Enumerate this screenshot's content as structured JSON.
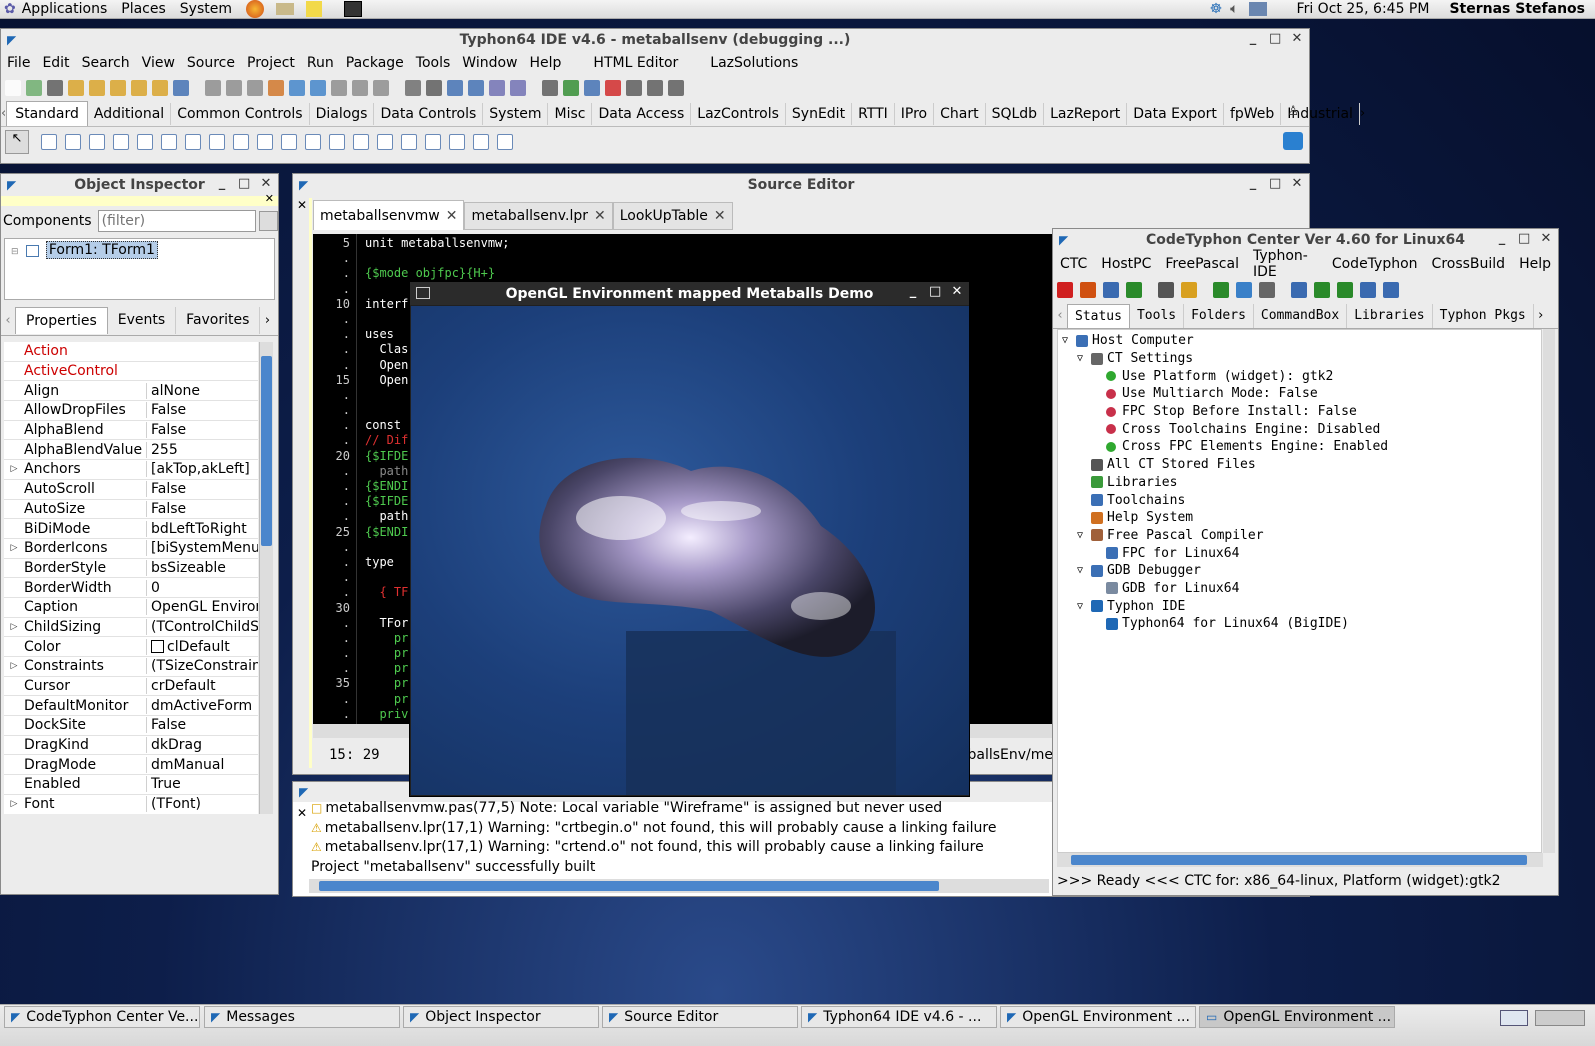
{
  "topbar": {
    "applications": "Applications",
    "places": "Places",
    "system": "System",
    "clock": "Fri Oct 25,  6:45 PM",
    "user": "Sternas Stefanos"
  },
  "ide": {
    "title": "Typhon64 IDE v4.6 - metaballsenv (debugging ...)",
    "menu": [
      "File",
      "Edit",
      "Search",
      "View",
      "Source",
      "Project",
      "Run",
      "Package",
      "Tools",
      "Window",
      "Help",
      "HTML Editor",
      "LazSolutions"
    ],
    "palette_tabs": [
      "Standard",
      "Additional",
      "Common Controls",
      "Dialogs",
      "Data Controls",
      "System",
      "Misc",
      "Data Access",
      "LazControls",
      "SynEdit",
      "RTTI",
      "IPro",
      "Chart",
      "SQLdb",
      "LazReport",
      "Data Export",
      "fpWeb",
      "Industrial"
    ]
  },
  "inspector": {
    "title": "Object Inspector",
    "components_label": "Components",
    "filter_placeholder": "(filter)",
    "tree_item": "Form1: TForm1",
    "tabs": [
      "Properties",
      "Events",
      "Favorites"
    ],
    "props": [
      {
        "n": "Action",
        "v": "",
        "red": true,
        "e": ""
      },
      {
        "n": "ActiveControl",
        "v": "",
        "red": true,
        "e": ""
      },
      {
        "n": "Align",
        "v": "alNone",
        "e": ""
      },
      {
        "n": "AllowDropFiles",
        "v": "False",
        "e": ""
      },
      {
        "n": "AlphaBlend",
        "v": "False",
        "e": ""
      },
      {
        "n": "AlphaBlendValue",
        "v": "255",
        "e": ""
      },
      {
        "n": "Anchors",
        "v": "[akTop,akLeft]",
        "e": "▷"
      },
      {
        "n": "AutoScroll",
        "v": "False",
        "e": ""
      },
      {
        "n": "AutoSize",
        "v": "False",
        "e": ""
      },
      {
        "n": "BiDiMode",
        "v": "bdLeftToRight",
        "e": ""
      },
      {
        "n": "BorderIcons",
        "v": "[biSystemMenu,b",
        "e": "▷"
      },
      {
        "n": "BorderStyle",
        "v": "bsSizeable",
        "e": ""
      },
      {
        "n": "BorderWidth",
        "v": "0",
        "e": ""
      },
      {
        "n": "Caption",
        "v": "OpenGL Environn",
        "e": ""
      },
      {
        "n": "ChildSizing",
        "v": "(TControlChildSiz",
        "e": "▷"
      },
      {
        "n": "Color",
        "v": "clDefault",
        "e": "",
        "swatch": true
      },
      {
        "n": "Constraints",
        "v": "(TSizeConstraints",
        "e": "▷"
      },
      {
        "n": "Cursor",
        "v": "crDefault",
        "e": ""
      },
      {
        "n": "DefaultMonitor",
        "v": "dmActiveForm",
        "e": ""
      },
      {
        "n": "DockSite",
        "v": "False",
        "e": ""
      },
      {
        "n": "DragKind",
        "v": "dkDrag",
        "e": ""
      },
      {
        "n": "DragMode",
        "v": "dmManual",
        "e": ""
      },
      {
        "n": "Enabled",
        "v": "True",
        "e": ""
      },
      {
        "n": "Font",
        "v": "(TFont)",
        "e": "▷"
      }
    ]
  },
  "source": {
    "title": "Source Editor",
    "tabs": [
      "metaballsenvmw",
      "metaballsenv.lpr",
      "LookUpTable"
    ],
    "cursor_pos": "15: 29",
    "path_fragment": "aballsEnv/me",
    "gutter": [
      "5",
      ".",
      ".",
      ".",
      "10",
      ".",
      ".",
      ".",
      ".",
      "15",
      ".",
      ".",
      ".",
      ".",
      "20",
      ".",
      ".",
      ".",
      ".",
      "25",
      ".",
      ".",
      ".",
      ".",
      "30",
      ".",
      ".",
      ".",
      ".",
      "35",
      ".",
      "."
    ],
    "lines": [
      {
        "t": "unit metaballsenvmw;",
        "c": "#ffffff"
      },
      {
        "t": "",
        "c": "#fff"
      },
      {
        "t": "{$mode objfpc}{H+}",
        "c": "#4ec94e"
      },
      {
        "t": "",
        "c": "#fff"
      },
      {
        "t": "interface",
        "c": "#ffffff"
      },
      {
        "t": "",
        "c": "#fff"
      },
      {
        "t": "uses",
        "c": "#ffffff"
      },
      {
        "t": "  Class",
        "c": "#ffffff"
      },
      {
        "t": "  OpenG",
        "c": "#ffffff"
      },
      {
        "t": "  OpenG",
        "c": "#ffffff"
      },
      {
        "t": "",
        "c": "#fff"
      },
      {
        "t": "",
        "c": "#fff"
      },
      {
        "t": "const",
        "c": "#ffffff"
      },
      {
        "t": "// Dif",
        "c": "#e03030"
      },
      {
        "t": "{$IFDEF",
        "c": "#4ec94e"
      },
      {
        "t": "  path",
        "c": "#888888"
      },
      {
        "t": "{$ENDIF",
        "c": "#4ec94e"
      },
      {
        "t": "{$IFDEF",
        "c": "#4ec94e"
      },
      {
        "t": "  path",
        "c": "#ffffff"
      },
      {
        "t": "{$ENDIF",
        "c": "#4ec94e"
      },
      {
        "t": "",
        "c": "#fff"
      },
      {
        "t": "type",
        "c": "#ffffff"
      },
      {
        "t": "",
        "c": "#fff"
      },
      {
        "t": "  { TFo",
        "c": "#e03030"
      },
      {
        "t": "",
        "c": "#fff"
      },
      {
        "t": "  TForm",
        "c": "#ffffff"
      },
      {
        "t": "    pro",
        "c": "#4ec94e"
      },
      {
        "t": "    pro",
        "c": "#4ec94e"
      },
      {
        "t": "    pro",
        "c": "#4ec94e"
      },
      {
        "t": "    pro",
        "c": "#4ec94e"
      },
      {
        "t": "    pro",
        "c": "#4ec94e"
      },
      {
        "t": "  priva",
        "c": "#4ec94e"
      }
    ]
  },
  "messages": {
    "lines": [
      {
        "t": "metaballsenvmw.pas(77,5) Note: Local variable \"Wireframe\" is assigned but never used",
        "warn": false
      },
      {
        "t": "metaballsenv.lpr(17,1) Warning: \"crtbegin.o\" not found, this will probably cause a linking failure",
        "warn": true
      },
      {
        "t": "metaballsenv.lpr(17,1) Warning: \"crtend.o\" not found, this will probably cause a linking failure",
        "warn": true
      },
      {
        "t": "Project \"metaballsenv\" successfully built",
        "warn": false
      }
    ]
  },
  "ogl": {
    "title": "OpenGL Environment mapped Metaballs Demo"
  },
  "ctc": {
    "title": "CodeTyphon Center Ver 4.60 for Linux64",
    "menu": [
      "CTC",
      "HostPC",
      "FreePascal",
      "Typhon-IDE",
      "CodeTyphon",
      "CrossBuild",
      "Help"
    ],
    "tabs": [
      "Status",
      "Tools",
      "Folders",
      "CommandBox",
      "Libraries",
      "Typhon Pkgs"
    ],
    "tree": [
      {
        "t": "Host Computer",
        "lvl": 0,
        "exp": "▽",
        "icon": "#3b6fb5",
        "dot": ""
      },
      {
        "t": "CT Settings",
        "lvl": 1,
        "exp": "▽",
        "icon": "#666",
        "dot": ""
      },
      {
        "t": "Use Platform (widget): gtk2",
        "lvl": 2,
        "exp": "",
        "icon": "",
        "dot": "#2fa82f"
      },
      {
        "t": "Use Multiarch Mode: False",
        "lvl": 2,
        "exp": "",
        "icon": "",
        "dot": "#c8304a"
      },
      {
        "t": "FPC Stop Before Install: False",
        "lvl": 2,
        "exp": "",
        "icon": "",
        "dot": "#c8304a"
      },
      {
        "t": "Cross Toolchains Engine: Disabled",
        "lvl": 2,
        "exp": "",
        "icon": "",
        "dot": "#c8304a"
      },
      {
        "t": "Cross FPC Elements Engine: Enabled",
        "lvl": 2,
        "exp": "",
        "icon": "",
        "dot": "#2fa82f"
      },
      {
        "t": "All CT Stored Files",
        "lvl": 1,
        "exp": "",
        "icon": "#555",
        "dot": ""
      },
      {
        "t": "Libraries",
        "lvl": 1,
        "exp": "",
        "icon": "#3a9a3a",
        "dot": ""
      },
      {
        "t": "Toolchains",
        "lvl": 1,
        "exp": "",
        "icon": "#3b6fb5",
        "dot": ""
      },
      {
        "t": "Help System",
        "lvl": 1,
        "exp": "",
        "icon": "#d07020",
        "dot": ""
      },
      {
        "t": "Free Pascal Compiler",
        "lvl": 1,
        "exp": "▽",
        "icon": "#a0603a",
        "dot": ""
      },
      {
        "t": "FPC for Linux64",
        "lvl": 2,
        "exp": "",
        "icon": "#3b6fb5",
        "dot": ""
      },
      {
        "t": "GDB Debugger",
        "lvl": 1,
        "exp": "▽",
        "icon": "#3b6fb5",
        "dot": ""
      },
      {
        "t": "GDB for Linux64",
        "lvl": 2,
        "exp": "",
        "icon": "#7a8aa0",
        "dot": ""
      },
      {
        "t": "Typhon IDE",
        "lvl": 1,
        "exp": "▽",
        "icon": "#1f68b5",
        "dot": ""
      },
      {
        "t": "Typhon64 for Linux64 (BigIDE)",
        "lvl": 2,
        "exp": "",
        "icon": "#1f68b5",
        "dot": ""
      }
    ],
    "status": ">>> Ready <<<  CTC for: x86_64-linux, Platform (widget):gtk2"
  },
  "taskbar": [
    "CodeTyphon Center Ve...",
    "Messages",
    "Object Inspector",
    "Source Editor",
    "Typhon64 IDE v4.6 - ...",
    "OpenGL Environment ...",
    "OpenGL Environment ..."
  ]
}
